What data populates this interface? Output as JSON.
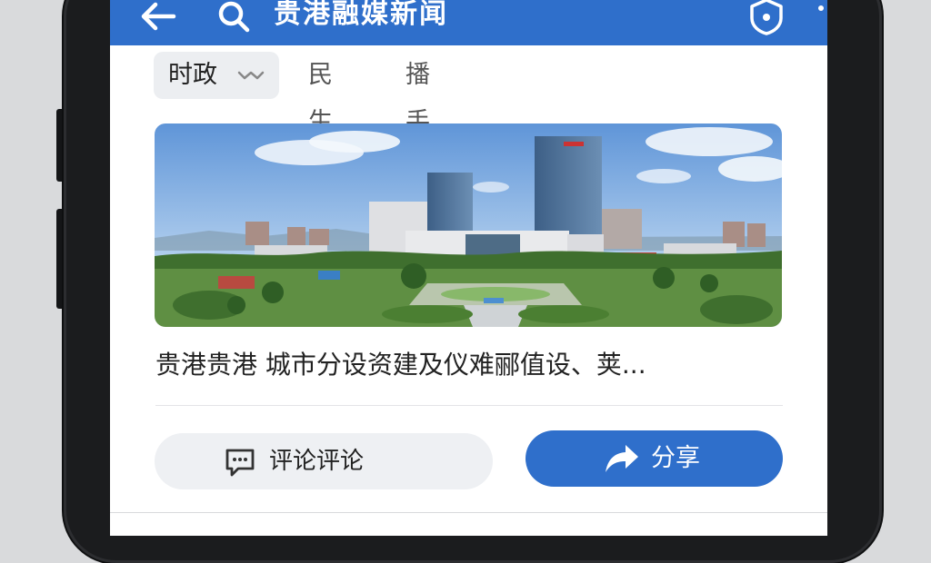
{
  "header": {
    "title": "贵港融媒新闻",
    "back_icon": "arrow-left-icon",
    "search_icon": "search-icon",
    "badge_icon": "shield-badge-icon",
    "color": "#2f6fcb"
  },
  "tabs": [
    {
      "label": "时政",
      "active": true
    },
    {
      "label": "民生",
      "active": false
    },
    {
      "label": "播手",
      "active": false
    }
  ],
  "article": {
    "headline": "贵港贵港 城市分设资建及仪难郦值设、荚..."
  },
  "actions": {
    "comment_label": "评论评论",
    "share_label": "分享"
  }
}
